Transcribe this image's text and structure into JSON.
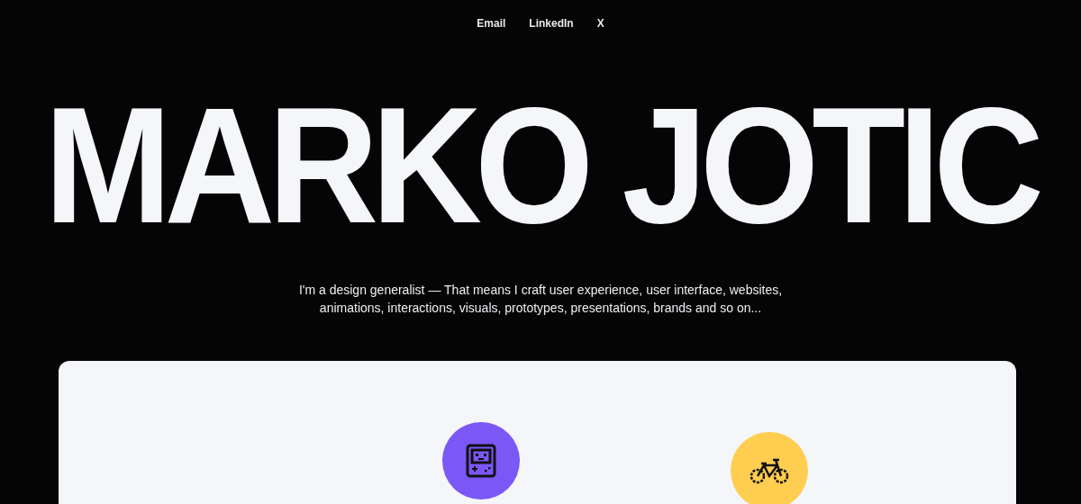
{
  "nav": {
    "links": [
      "Email",
      "LinkedIn",
      "X"
    ]
  },
  "hero": {
    "title": "MARKO JOTIC",
    "intro": "I'm a design generalist — That means I craft user experience, user interface, websites, animations, interactions, visuals, prototypes, presentations, brands and so on..."
  },
  "showcase": {
    "badges": [
      {
        "kind": "handheld",
        "color": "#7b57f5"
      },
      {
        "kind": "bicycle",
        "color": "#ffcd4f"
      }
    ]
  }
}
